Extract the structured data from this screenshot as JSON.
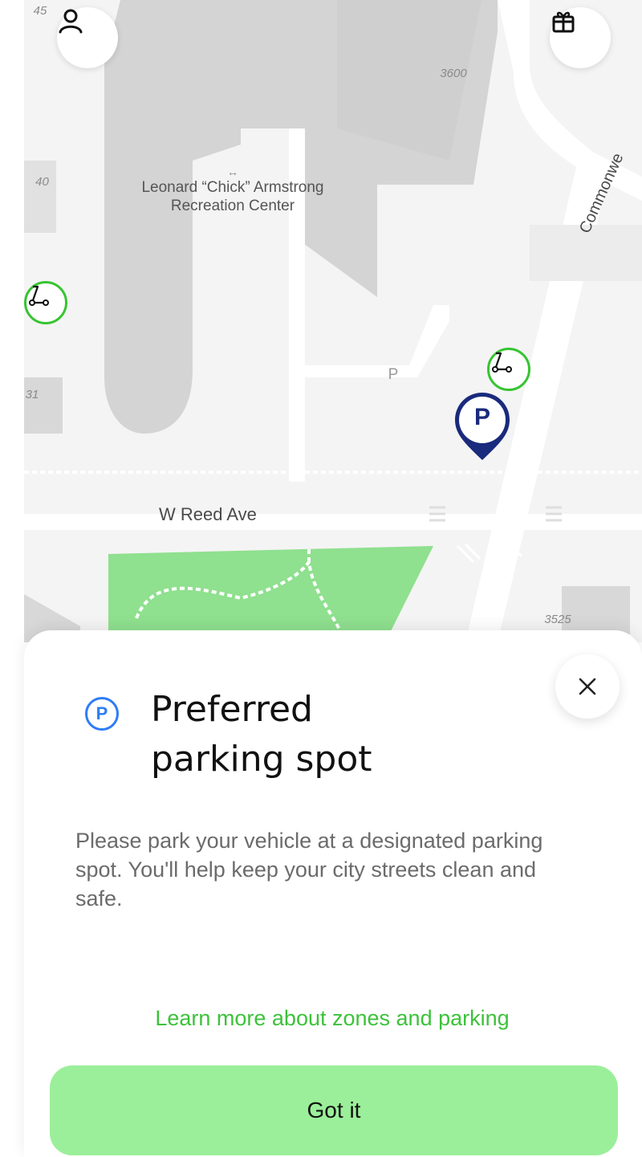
{
  "map": {
    "place_label": "Leonard “Chick” Armstrong Recreation Center",
    "place_line1": "Leonard “Chick” Armstrong",
    "place_line2": "Recreation Center",
    "street_reed": "W Reed Ave",
    "street_commonwealth": "Commonwe",
    "number_3600": "3600",
    "number_3525": "3525",
    "number_45": "45",
    "number_40": "40",
    "number_31": "31",
    "parking_letter": "P",
    "pin_letter": "P",
    "colors": {
      "scooter_ring": "#36c431",
      "pin": "#1a2a7c",
      "park": "#8fe08f"
    }
  },
  "header": {
    "profile_icon": "person-icon",
    "gift_icon": "gift-icon"
  },
  "sheet": {
    "icon_letter": "P",
    "title": "Preferred parking spot",
    "title_line1": "Preferred",
    "title_line2": "parking spot",
    "description": "Please park your vehicle at a designated parking spot. You'll help keep your city streets clean and safe.",
    "learn_more": "Learn more about zones and parking",
    "button_label": "Got it",
    "colors": {
      "accent_blue": "#2e7df6",
      "link_green": "#3cc23a",
      "button_green": "#9bef9a"
    }
  }
}
